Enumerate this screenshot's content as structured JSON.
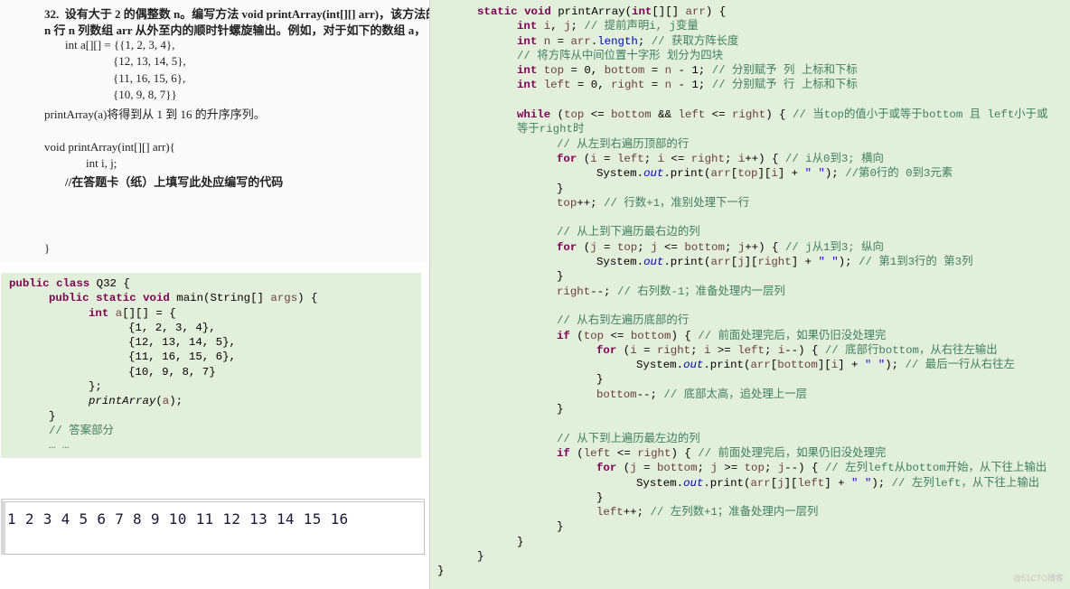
{
  "question": {
    "lines": [
      "32.  设有大于 2 的偶整数 n。编写方法 void printArray(int[][] arr)，该方法的功能是实现",
      "n 行 n 列数组 arr 从外至内的顺时针螺旋输出。例如，对于如下的数组 a，",
      "int a[][] = {{1, 2, 3, 4},",
      "{12, 13, 14, 5},",
      "{11, 16, 15, 6},",
      "{10, 9, 8, 7}}",
      "printArray(a)将得到从 1 到 16 的升序序列。",
      "void printArray(int[][] arr){",
      "int i, j;",
      "//在答题卡（纸）上填写此处应编写的代码",
      "}"
    ]
  },
  "left_code": [
    [
      [
        "k",
        "public"
      ],
      [
        "p",
        " "
      ],
      [
        "k",
        "class"
      ],
      [
        "p",
        " Q32 {"
      ]
    ],
    [
      [
        "p",
        "\t"
      ],
      [
        "k",
        "public"
      ],
      [
        "p",
        " "
      ],
      [
        "k",
        "static"
      ],
      [
        "p",
        " "
      ],
      [
        "k",
        "void"
      ],
      [
        "p",
        " main(String[] "
      ],
      [
        "v",
        "args"
      ],
      [
        "p",
        ") {"
      ]
    ],
    [
      [
        "p",
        "\t\t"
      ],
      [
        "k",
        "int"
      ],
      [
        "p",
        " "
      ],
      [
        "v",
        "a"
      ],
      [
        "p",
        "[][] = {"
      ]
    ],
    [
      [
        "p",
        "\t\t\t{1, 2, 3, 4},"
      ]
    ],
    [
      [
        "p",
        "\t\t\t{12, 13, 14, 5},"
      ]
    ],
    [
      [
        "p",
        "\t\t\t{11, 16, 15, 6},"
      ]
    ],
    [
      [
        "p",
        "\t\t\t{10, 9, 8, 7}"
      ]
    ],
    [
      [
        "p",
        "\t\t};"
      ]
    ],
    [
      [
        "p",
        "\t\t"
      ],
      [
        "i",
        "printArray"
      ],
      [
        "p",
        "("
      ],
      [
        "v",
        "a"
      ],
      [
        "p",
        ");"
      ]
    ],
    [
      [
        "p",
        "\t}"
      ]
    ],
    [
      [
        "p",
        "\t"
      ],
      [
        "c",
        "// 答案部分"
      ]
    ],
    [
      [
        "p",
        "\t"
      ],
      [
        "c",
        "… …"
      ]
    ]
  ],
  "right_code": [
    [
      [
        "p",
        "\t"
      ],
      [
        "k",
        "static"
      ],
      [
        "p",
        " "
      ],
      [
        "k",
        "void"
      ],
      [
        "p",
        " printArray("
      ],
      [
        "k",
        "int"
      ],
      [
        "p",
        "[][] "
      ],
      [
        "v",
        "arr"
      ],
      [
        "p",
        ") {"
      ]
    ],
    [
      [
        "p",
        "\t\t"
      ],
      [
        "k",
        "int"
      ],
      [
        "p",
        " "
      ],
      [
        "v",
        "i"
      ],
      [
        "p",
        ", "
      ],
      [
        "v",
        "j"
      ],
      [
        "p",
        "; "
      ],
      [
        "c",
        "// 提前声明i, j变量"
      ]
    ],
    [
      [
        "p",
        "\t\t"
      ],
      [
        "k",
        "int"
      ],
      [
        "p",
        " "
      ],
      [
        "v",
        "n"
      ],
      [
        "p",
        " = "
      ],
      [
        "v",
        "arr"
      ],
      [
        "p",
        "."
      ],
      [
        "fn",
        "length"
      ],
      [
        "p",
        "; "
      ],
      [
        "c",
        "// 获取方阵长度"
      ]
    ],
    [
      [
        "p",
        "\t\t"
      ],
      [
        "c",
        "// 将方阵从中间位置十字形 划分为四块"
      ]
    ],
    [
      [
        "p",
        "\t\t"
      ],
      [
        "k",
        "int"
      ],
      [
        "p",
        " "
      ],
      [
        "v",
        "top"
      ],
      [
        "p",
        " = 0, "
      ],
      [
        "v",
        "bottom"
      ],
      [
        "p",
        " = "
      ],
      [
        "v",
        "n"
      ],
      [
        "p",
        " - 1; "
      ],
      [
        "c",
        "// 分别赋予 列 上标和下标"
      ]
    ],
    [
      [
        "p",
        "\t\t"
      ],
      [
        "k",
        "int"
      ],
      [
        "p",
        " "
      ],
      [
        "v",
        "left"
      ],
      [
        "p",
        " = 0, "
      ],
      [
        "v",
        "right"
      ],
      [
        "p",
        " = "
      ],
      [
        "v",
        "n"
      ],
      [
        "p",
        " - 1; "
      ],
      [
        "c",
        "// 分别赋予 行 上标和下标"
      ]
    ],
    [],
    [
      [
        "p",
        "\t\t"
      ],
      [
        "k",
        "while"
      ],
      [
        "p",
        " ("
      ],
      [
        "v",
        "top"
      ],
      [
        "p",
        " <= "
      ],
      [
        "v",
        "bottom"
      ],
      [
        "p",
        " && "
      ],
      [
        "v",
        "left"
      ],
      [
        "p",
        " <= "
      ],
      [
        "v",
        "right"
      ],
      [
        "p",
        ") { "
      ],
      [
        "c",
        "// 当top的值小于或等于bottom 且 left小于或"
      ]
    ],
    [
      [
        "p",
        "\t\t"
      ],
      [
        "c",
        "等于right时"
      ]
    ],
    [
      [
        "p",
        "\t\t\t"
      ],
      [
        "c",
        "// 从左到右遍历顶部的行"
      ]
    ],
    [
      [
        "p",
        "\t\t\t"
      ],
      [
        "k",
        "for"
      ],
      [
        "p",
        " ("
      ],
      [
        "v",
        "i"
      ],
      [
        "p",
        " = "
      ],
      [
        "v",
        "left"
      ],
      [
        "p",
        "; "
      ],
      [
        "v",
        "i"
      ],
      [
        "p",
        " <= "
      ],
      [
        "v",
        "right"
      ],
      [
        "p",
        "; "
      ],
      [
        "v",
        "i"
      ],
      [
        "p",
        "++) { "
      ],
      [
        "c",
        "// i从0到3; 横向"
      ]
    ],
    [
      [
        "p",
        "\t\t\t\tSystem."
      ],
      [
        "f",
        "out"
      ],
      [
        "p",
        ".print("
      ],
      [
        "v",
        "arr"
      ],
      [
        "p",
        "["
      ],
      [
        "v",
        "top"
      ],
      [
        "p",
        "]["
      ],
      [
        "v",
        "i"
      ],
      [
        "p",
        "] + "
      ],
      [
        "s",
        "\" \""
      ],
      [
        "p",
        "); "
      ],
      [
        "c",
        "//第0行的 0到3元素"
      ]
    ],
    [
      [
        "p",
        "\t\t\t}"
      ]
    ],
    [
      [
        "p",
        "\t\t\t"
      ],
      [
        "v",
        "top"
      ],
      [
        "p",
        "++; "
      ],
      [
        "c",
        "// 行数+1，准别处理下一行"
      ]
    ],
    [],
    [
      [
        "p",
        "\t\t\t"
      ],
      [
        "c",
        "// 从上到下遍历最右边的列"
      ]
    ],
    [
      [
        "p",
        "\t\t\t"
      ],
      [
        "k",
        "for"
      ],
      [
        "p",
        " ("
      ],
      [
        "v",
        "j"
      ],
      [
        "p",
        " = "
      ],
      [
        "v",
        "top"
      ],
      [
        "p",
        "; "
      ],
      [
        "v",
        "j"
      ],
      [
        "p",
        " <= "
      ],
      [
        "v",
        "bottom"
      ],
      [
        "p",
        "; "
      ],
      [
        "v",
        "j"
      ],
      [
        "p",
        "++) { "
      ],
      [
        "c",
        "// j从1到3; 纵向"
      ]
    ],
    [
      [
        "p",
        "\t\t\t\tSystem."
      ],
      [
        "f",
        "out"
      ],
      [
        "p",
        ".print("
      ],
      [
        "v",
        "arr"
      ],
      [
        "p",
        "["
      ],
      [
        "v",
        "j"
      ],
      [
        "p",
        "]["
      ],
      [
        "v",
        "right"
      ],
      [
        "p",
        "] + "
      ],
      [
        "s",
        "\" \""
      ],
      [
        "p",
        "); "
      ],
      [
        "c",
        "// 第1到3行的 第3列"
      ]
    ],
    [
      [
        "p",
        "\t\t\t}"
      ]
    ],
    [
      [
        "p",
        "\t\t\t"
      ],
      [
        "v",
        "right"
      ],
      [
        "p",
        "--; "
      ],
      [
        "c",
        "// 右列数-1；准备处理内一层列"
      ]
    ],
    [],
    [
      [
        "p",
        "\t\t\t"
      ],
      [
        "c",
        "// 从右到左遍历底部的行"
      ]
    ],
    [
      [
        "p",
        "\t\t\t"
      ],
      [
        "k",
        "if"
      ],
      [
        "p",
        " ("
      ],
      [
        "v",
        "top"
      ],
      [
        "p",
        " <= "
      ],
      [
        "v",
        "bottom"
      ],
      [
        "p",
        ") { "
      ],
      [
        "c",
        "// 前面处理完后，如果仍旧没处理完"
      ]
    ],
    [
      [
        "p",
        "\t\t\t\t"
      ],
      [
        "k",
        "for"
      ],
      [
        "p",
        " ("
      ],
      [
        "v",
        "i"
      ],
      [
        "p",
        " = "
      ],
      [
        "v",
        "right"
      ],
      [
        "p",
        "; "
      ],
      [
        "v",
        "i"
      ],
      [
        "p",
        " >= "
      ],
      [
        "v",
        "left"
      ],
      [
        "p",
        "; "
      ],
      [
        "v",
        "i"
      ],
      [
        "p",
        "--) { "
      ],
      [
        "c",
        "// 底部行bottom，从右往左输出"
      ]
    ],
    [
      [
        "p",
        "\t\t\t\t\tSystem."
      ],
      [
        "f",
        "out"
      ],
      [
        "p",
        ".print("
      ],
      [
        "v",
        "arr"
      ],
      [
        "p",
        "["
      ],
      [
        "v",
        "bottom"
      ],
      [
        "p",
        "]["
      ],
      [
        "v",
        "i"
      ],
      [
        "p",
        "] + "
      ],
      [
        "s",
        "\" \""
      ],
      [
        "p",
        "); "
      ],
      [
        "c",
        "// 最后一行从右往左"
      ]
    ],
    [
      [
        "p",
        "\t\t\t\t}"
      ]
    ],
    [
      [
        "p",
        "\t\t\t\t"
      ],
      [
        "v",
        "bottom"
      ],
      [
        "p",
        "--; "
      ],
      [
        "c",
        "// 底部太高，追处理上一层"
      ]
    ],
    [
      [
        "p",
        "\t\t\t}"
      ]
    ],
    [],
    [
      [
        "p",
        "\t\t\t"
      ],
      [
        "c",
        "// 从下到上遍历最左边的列"
      ]
    ],
    [
      [
        "p",
        "\t\t\t"
      ],
      [
        "k",
        "if"
      ],
      [
        "p",
        " ("
      ],
      [
        "v",
        "left"
      ],
      [
        "p",
        " <= "
      ],
      [
        "v",
        "right"
      ],
      [
        "p",
        ") { "
      ],
      [
        "c",
        "// 前面处理完后，如果仍旧没处理完"
      ]
    ],
    [
      [
        "p",
        "\t\t\t\t"
      ],
      [
        "k",
        "for"
      ],
      [
        "p",
        " ("
      ],
      [
        "v",
        "j"
      ],
      [
        "p",
        " = "
      ],
      [
        "v",
        "bottom"
      ],
      [
        "p",
        "; "
      ],
      [
        "v",
        "j"
      ],
      [
        "p",
        " >= "
      ],
      [
        "v",
        "top"
      ],
      [
        "p",
        "; "
      ],
      [
        "v",
        "j"
      ],
      [
        "p",
        "--) { "
      ],
      [
        "c",
        "// 左列left从bottom开始，从下往上输出"
      ]
    ],
    [
      [
        "p",
        "\t\t\t\t\tSystem."
      ],
      [
        "f",
        "out"
      ],
      [
        "p",
        ".print("
      ],
      [
        "v",
        "arr"
      ],
      [
        "p",
        "["
      ],
      [
        "v",
        "j"
      ],
      [
        "p",
        "]["
      ],
      [
        "v",
        "left"
      ],
      [
        "p",
        "] + "
      ],
      [
        "s",
        "\" \""
      ],
      [
        "p",
        "); "
      ],
      [
        "c",
        "// 左列left，从下往上输出"
      ]
    ],
    [
      [
        "p",
        "\t\t\t\t}"
      ]
    ],
    [
      [
        "p",
        "\t\t\t\t"
      ],
      [
        "v",
        "left"
      ],
      [
        "p",
        "++; "
      ],
      [
        "c",
        "// 左列数+1；准备处理内一层列"
      ]
    ],
    [
      [
        "p",
        "\t\t\t}"
      ]
    ],
    [
      [
        "p",
        "\t\t}"
      ]
    ],
    [
      [
        "p",
        "\t}"
      ]
    ],
    [
      [
        "p",
        "}"
      ]
    ]
  ],
  "console": {
    "output": "1 2 3 4 5 6 7 8 9 10 11 12 13 14 15 16"
  },
  "watermark": "@51CTO博客",
  "colors": {
    "code_background": "#e2efda",
    "keyword": "#7f0055",
    "variable": "#6a3e3e",
    "comment": "#3f7f5f",
    "field": "#0000c0",
    "string": "#2a00ff"
  }
}
